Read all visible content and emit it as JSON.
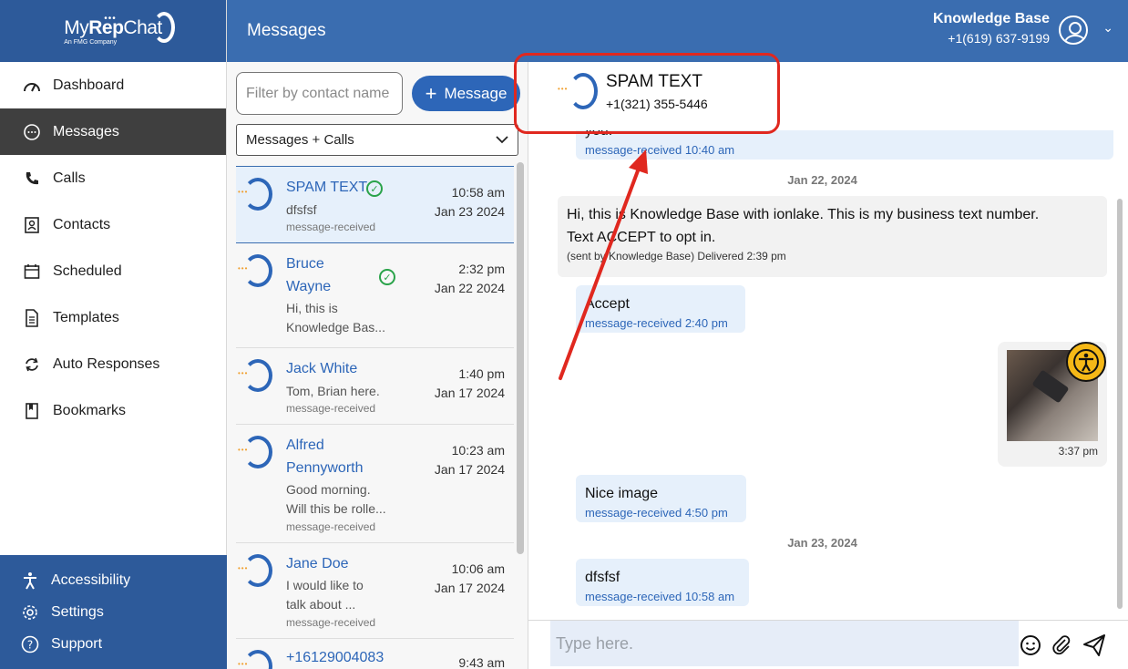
{
  "brand": {
    "name_light": "My",
    "name_bold": "Rep",
    "name_end": "Chat",
    "sub": "An FMG Company"
  },
  "sidebar": {
    "items": [
      {
        "label": "Dashboard",
        "icon": "gauge-icon"
      },
      {
        "label": "Messages",
        "icon": "chat-bubble-icon",
        "active": true
      },
      {
        "label": "Calls",
        "icon": "phone-icon"
      },
      {
        "label": "Contacts",
        "icon": "contact-card-icon"
      },
      {
        "label": "Scheduled",
        "icon": "calendar-icon"
      },
      {
        "label": "Templates",
        "icon": "document-icon"
      },
      {
        "label": "Auto Responses",
        "icon": "refresh-icon"
      },
      {
        "label": "Bookmarks",
        "icon": "bookmark-icon"
      }
    ],
    "bottom": [
      {
        "label": "Accessibility",
        "icon": "accessibility-icon"
      },
      {
        "label": "Settings",
        "icon": "gear-icon"
      },
      {
        "label": "Support",
        "icon": "help-icon"
      }
    ]
  },
  "header": {
    "title": "Messages",
    "user_name": "Knowledge Base",
    "user_phone": "+1(619) 637-9199"
  },
  "list": {
    "filter_placeholder": "Filter by contact name",
    "new_message_label": "Message",
    "view_select": "Messages + Calls",
    "conversations": [
      {
        "name": "SPAM TEXT",
        "time": "10:58 am",
        "date": "Jan 23 2024",
        "preview": "dfsfsf",
        "status": "message-received",
        "selected": true,
        "checked": true
      },
      {
        "name_line1": "Bruce",
        "name_line2": "Wayne",
        "time": "2:32 pm",
        "date": "Jan 22 2024",
        "preview_line1": "Hi, this is",
        "preview_line2": "Knowledge Bas...",
        "checked": true
      },
      {
        "name": "Jack White",
        "time": "1:40 pm",
        "date": "Jan 17 2024",
        "preview": "Tom, Brian here.",
        "status": "message-received"
      },
      {
        "name_line1": "Alfred",
        "name_line2": "Pennyworth",
        "time": "10:23 am",
        "date": "Jan 17 2024",
        "preview_line1": "Good morning.",
        "preview_line2": "Will this be rolle...",
        "status": "message-received"
      },
      {
        "name": "Jane Doe",
        "time": "10:06 am",
        "date": "Jan 17 2024",
        "preview_line1": "I would like to",
        "preview_line2": "talk about ...",
        "status": "message-received"
      },
      {
        "name": "+16129004083",
        "time": "9:43 am"
      }
    ]
  },
  "chat": {
    "contact_name": "SPAM TEXT",
    "contact_phone": "+1(321) 355-5446",
    "messages": [
      {
        "partial_text": "you.",
        "meta": "message-received 10:40 am"
      },
      {
        "date_sep": "Jan 22, 2024"
      },
      {
        "text_line1": "Hi, this is Knowledge Base with ionlake. This is my business text number.",
        "text_line2": "Text ACCEPT to opt in.",
        "meta": "(sent by Knowledge Base) Delivered 2:39 pm"
      },
      {
        "text": "Accept",
        "meta": "message-received 2:40 pm"
      },
      {
        "image_time": "3:37 pm"
      },
      {
        "text": "Nice image",
        "meta": "message-received 4:50 pm"
      },
      {
        "date_sep": "Jan 23, 2024"
      },
      {
        "text": "dfsfsf",
        "meta": "message-received 10:58 am"
      }
    ],
    "composer_placeholder": "Type here."
  },
  "colors": {
    "brand_blue": "#2d5a9a",
    "header_blue": "#3a6db0",
    "accent_blue": "#2d66b8",
    "annotation_red": "#e0281f",
    "dot_orange": "#f0a030"
  }
}
